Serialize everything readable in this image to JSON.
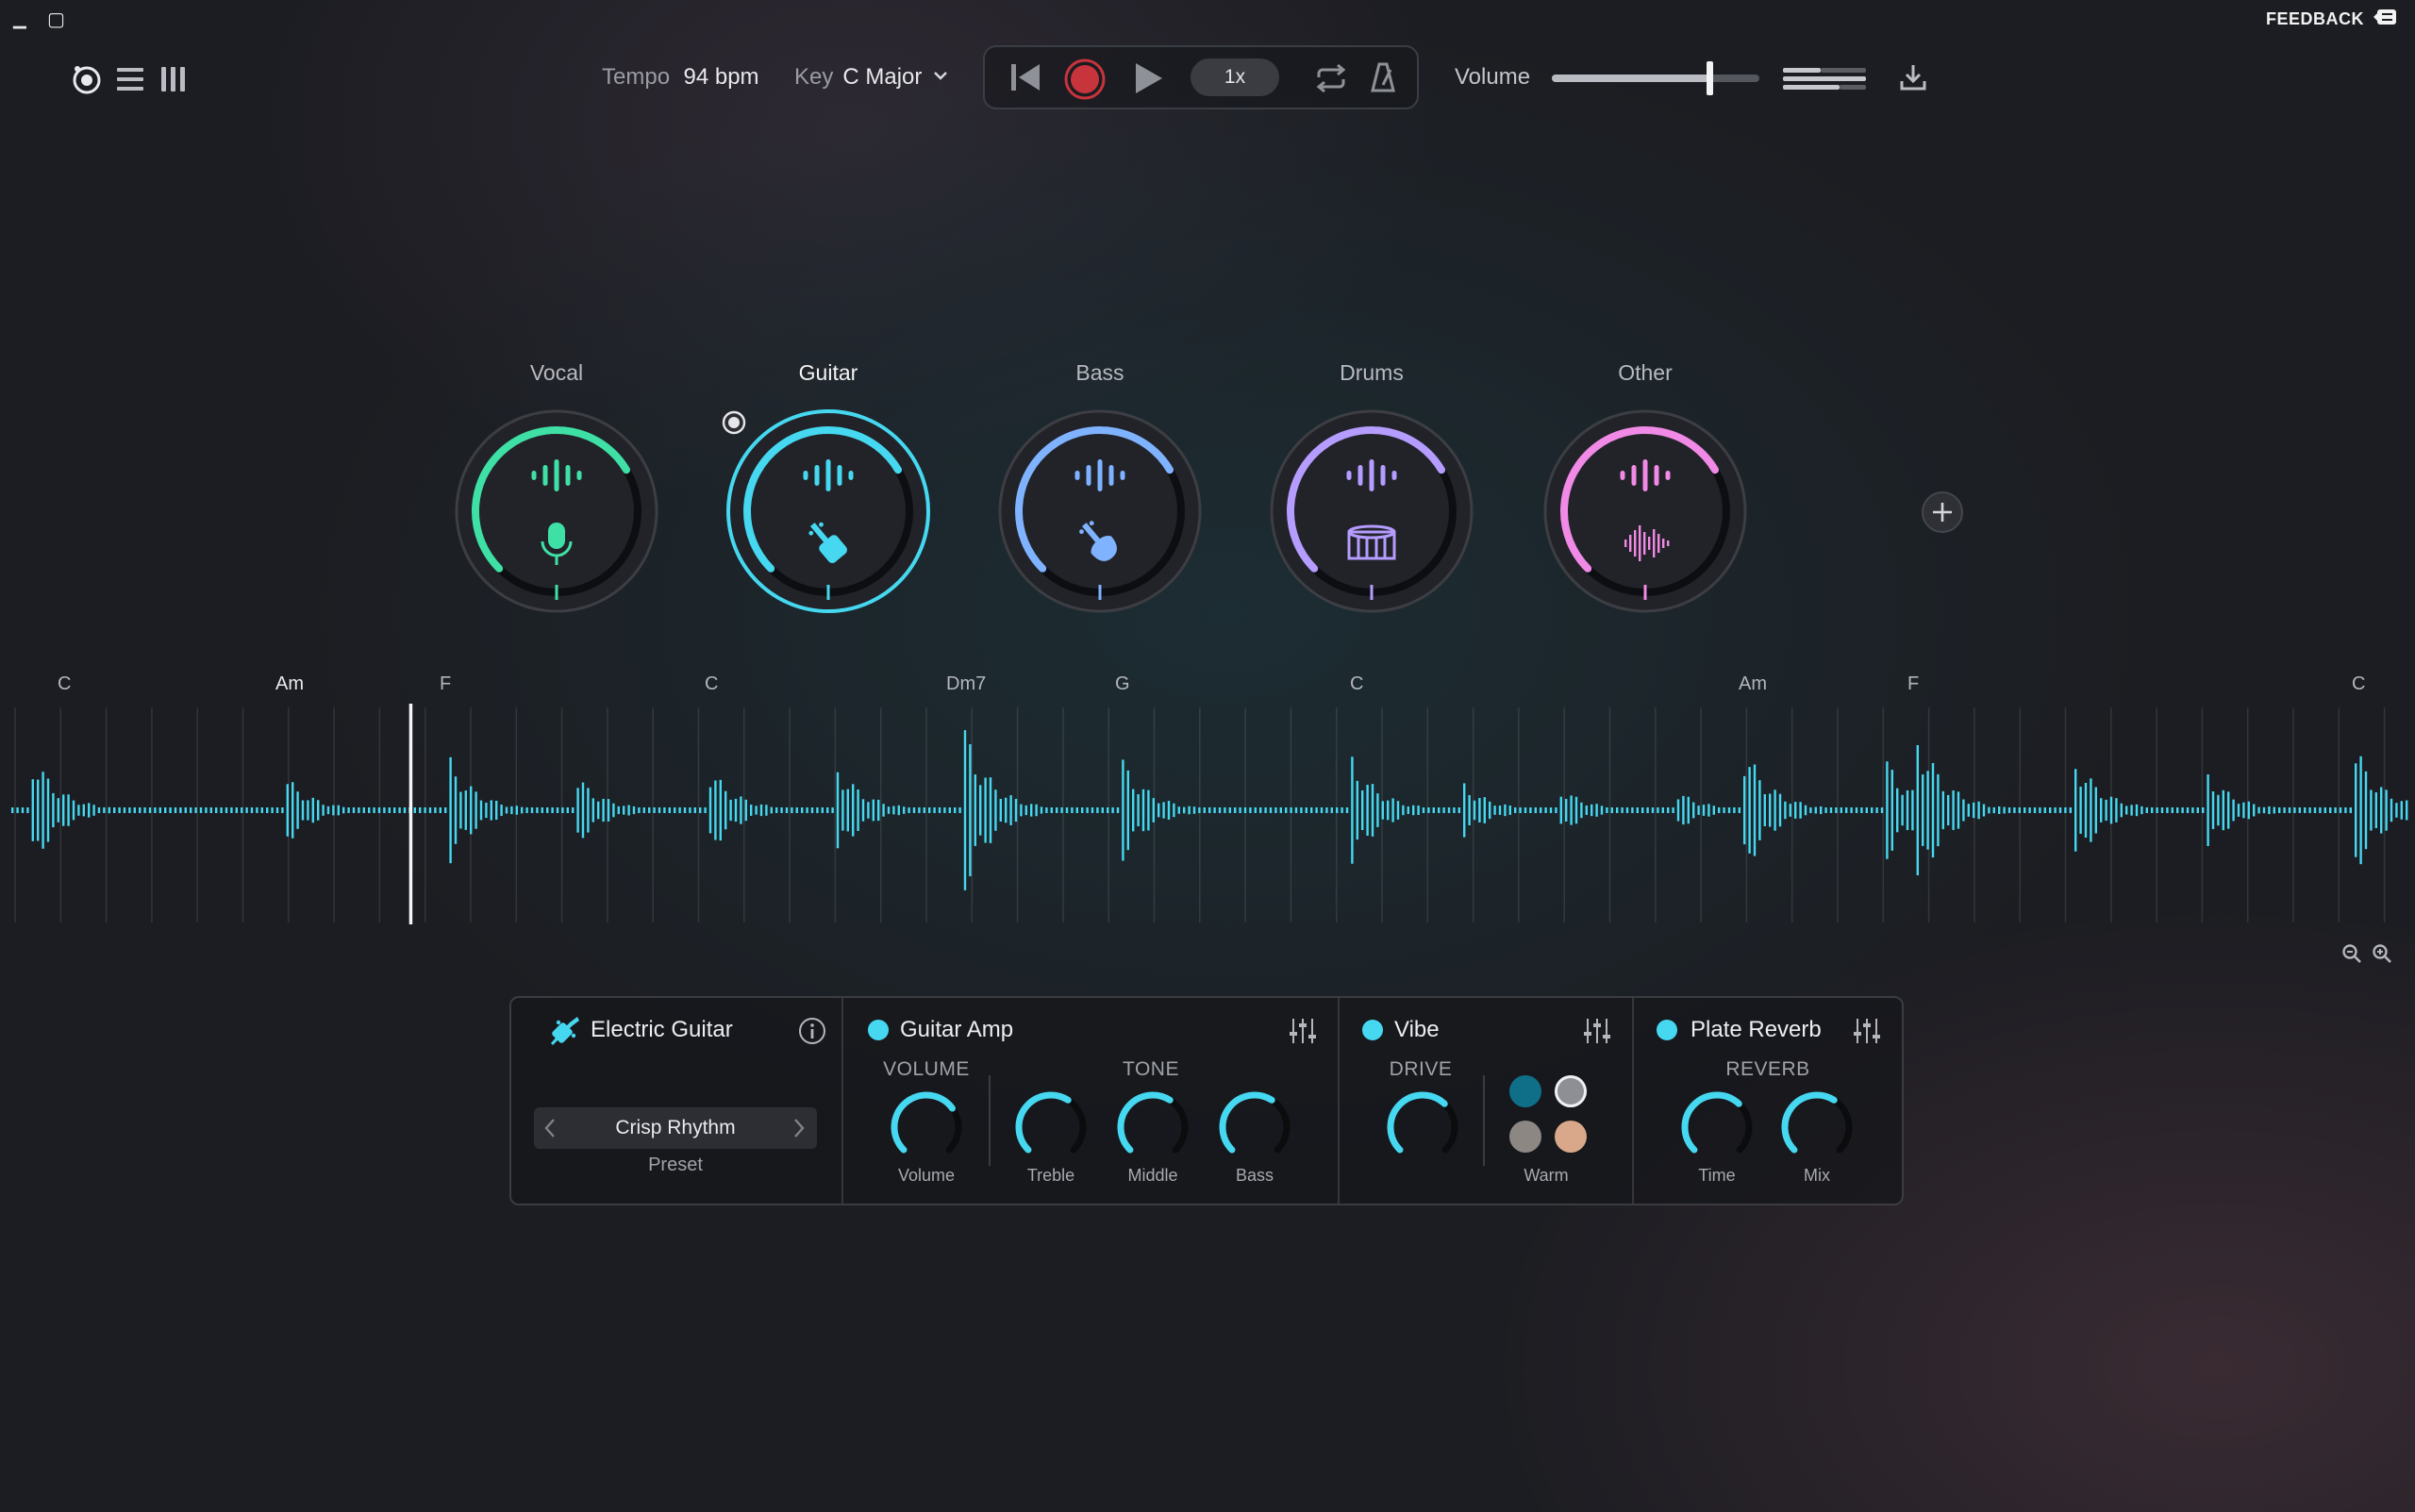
{
  "window": {
    "minimize_glyph": "▁",
    "maximize_glyph": "▢",
    "feedback_label": "FEEDBACK"
  },
  "toolbar": {
    "tempo_label": "Tempo",
    "tempo_value": "94 bpm",
    "key_label": "Key",
    "key_value": "C Major",
    "speed_value": "1x",
    "volume_label": "Volume",
    "volume_level": 0.76
  },
  "stems": [
    {
      "name": "Vocal",
      "icon": "microphone-icon",
      "color": "#3fe0a6",
      "level": 0.72,
      "selected": false
    },
    {
      "name": "Guitar",
      "icon": "guitar-icon",
      "color": "#45d8f0",
      "level": 0.72,
      "selected": true
    },
    {
      "name": "Bass",
      "icon": "bass-icon",
      "color": "#7fb2ff",
      "level": 0.72,
      "selected": false
    },
    {
      "name": "Drums",
      "icon": "drum-icon",
      "color": "#b59cff",
      "level": 0.72,
      "selected": false
    },
    {
      "name": "Other",
      "icon": "waveform-icon",
      "color": "#f08ae6",
      "level": 0.72,
      "selected": false
    }
  ],
  "timeline": {
    "chords": [
      "C",
      "Am",
      "F",
      "C",
      "Dm7",
      "G",
      "C",
      "Am",
      "F",
      "C"
    ],
    "chord_positions": [
      0.027,
      0.117,
      0.185,
      0.295,
      0.395,
      0.465,
      0.562,
      0.723,
      0.793,
      0.977
    ],
    "playhead_position": 0.17,
    "wave_color": "#45d8f0"
  },
  "panel": {
    "instrument": {
      "title": "Electric Guitar",
      "preset_value": "Crisp Rhythm",
      "preset_label": "Preset"
    },
    "amp": {
      "title": "Guitar Amp",
      "group_volume": "VOLUME",
      "group_tone": "TONE",
      "knobs": [
        {
          "label": "Volume",
          "value": 0.7
        },
        {
          "label": "Treble",
          "value": 0.62
        },
        {
          "label": "Middle",
          "value": 0.62
        },
        {
          "label": "Bass",
          "value": 0.62
        }
      ]
    },
    "vibe": {
      "title": "Vibe",
      "group_drive": "DRIVE",
      "knob_value": 0.66,
      "warm_label": "Warm",
      "swatches": [
        "#0f6f88",
        "#8d8f94",
        "#8d8784",
        "#d9a88a"
      ],
      "selected_swatch": 1
    },
    "reverb": {
      "title": "Plate Reverb",
      "group": "REVERB",
      "knobs": [
        {
          "label": "Time",
          "value": 0.66
        },
        {
          "label": "Mix",
          "value": 0.62
        }
      ]
    }
  }
}
